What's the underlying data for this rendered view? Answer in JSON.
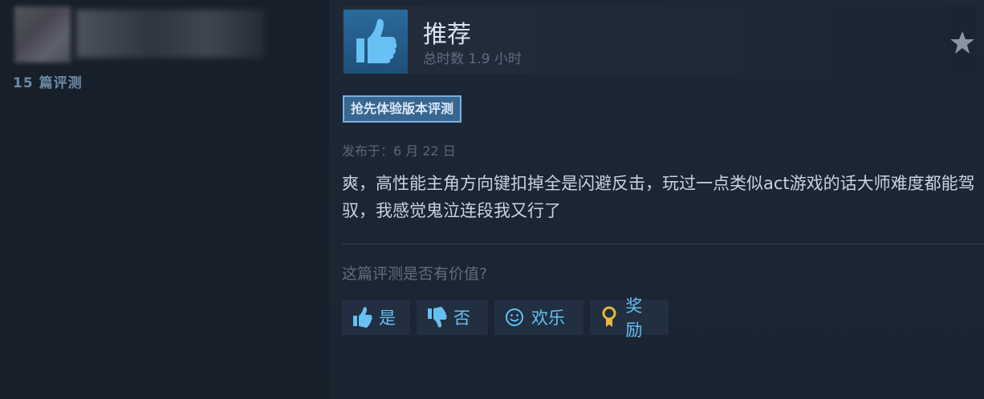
{
  "reviewer": {
    "review_count": "15 篇评测"
  },
  "review": {
    "verdict": "推荐",
    "playtime": "总时数 1.9 小时",
    "early_access_badge": "抢先体验版本评测",
    "posted": "发布于：6 月 22 日",
    "text": "爽，高性能主角方向键扣掉全是闪避反击，玩过一点类似act游戏的话大师难度都能驾驭，我感觉鬼泣连段我又行了"
  },
  "feedback": {
    "question": "这篇评测是否有价值?",
    "yes_label": "是",
    "no_label": "否",
    "funny_label": "欢乐",
    "award_label": "奖励"
  },
  "icons": {
    "verdict": "thumbs-up-icon",
    "star": "star-icon",
    "yes": "thumbs-up-icon",
    "no": "thumbs-down-icon",
    "funny": "smiley-icon",
    "award": "award-ribbon-icon"
  },
  "colors": {
    "background": "#1b2431",
    "accent_blue": "#66c0f4",
    "thumb_box": "#2b6a9c",
    "badge_bg": "#39668f",
    "badge_border": "#7ab0e0",
    "award_gold": "#e8b93a"
  }
}
